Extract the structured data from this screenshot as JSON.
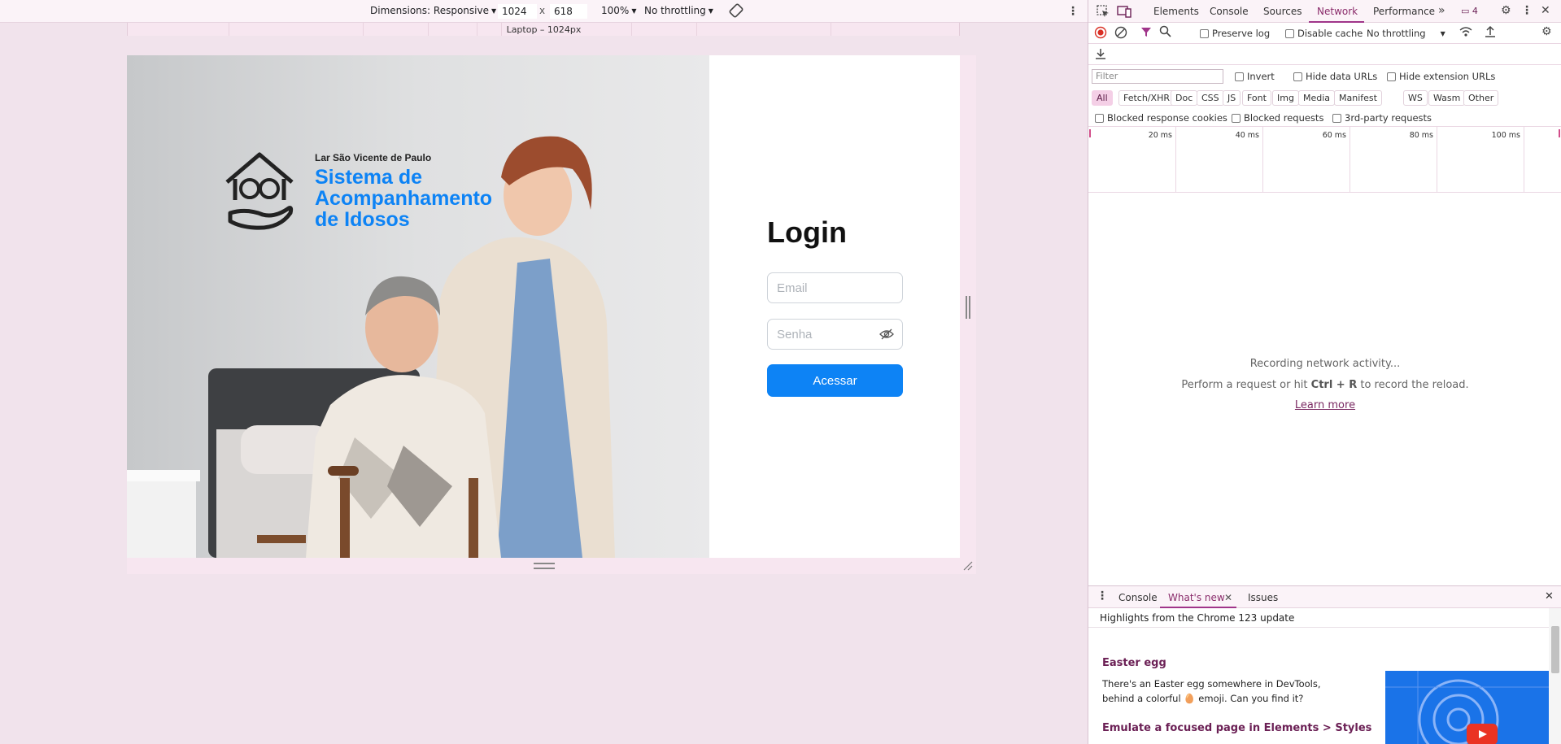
{
  "emulation": {
    "dimensions_label": "Dimensions: Responsive",
    "width_value": "1024",
    "times_sign": "x",
    "height_value": "618",
    "zoom": "100%",
    "throttling": "No throttling",
    "media_label": "Laptop – 1024px"
  },
  "page": {
    "logo_org": "Lar São Vicente de Paulo",
    "logo_title_line1": "Sistema de",
    "logo_title_line2": "Acompanhamento",
    "logo_title_line3": "de Idosos",
    "login_title": "Login",
    "email_placeholder": "Email",
    "password_placeholder": "Senha",
    "login_button": "Acessar",
    "accent_color": "#0d83f5"
  },
  "devtools": {
    "tabs": [
      "Elements",
      "Console",
      "Sources",
      "Network",
      "Performance"
    ],
    "active_tab": "Network",
    "more_tabs_icon": "double-chevron-right-icon",
    "issues_count": "4",
    "toolbar": {
      "preserve_log": "Preserve log",
      "disable_cache": "Disable cache",
      "throttling": "No throttling"
    },
    "filter": {
      "placeholder": "Filter",
      "invert": "Invert",
      "hide_data_urls": "Hide data URLs",
      "hide_extension_urls": "Hide extension URLs"
    },
    "types": [
      "All",
      "Fetch/XHR",
      "Doc",
      "CSS",
      "JS",
      "Font",
      "Img",
      "Media",
      "Manifest",
      "WS",
      "Wasm",
      "Other"
    ],
    "blocked": {
      "response_cookies": "Blocked response cookies",
      "requests": "Blocked requests",
      "third_party": "3rd-party requests"
    },
    "timeline_labels": [
      "20 ms",
      "40 ms",
      "60 ms",
      "80 ms",
      "100 ms"
    ],
    "empty_state": {
      "recording": "Recording network activity...",
      "hint_before": "Perform a request or hit ",
      "hint_key": "Ctrl + R",
      "hint_after": " to record the reload.",
      "learn_more": "Learn more"
    },
    "drawer": {
      "tabs": [
        "Console",
        "What's new",
        "Issues"
      ],
      "active_tab": "What's new",
      "header": "Highlights from the Chrome 123 update",
      "item1_title": "Easter egg",
      "item1_text": "There's an Easter egg somewhere in DevTools, behind a colorful 🥚 emoji. Can you find it?",
      "item2_title": "Emulate a focused page in Elements > Styles"
    },
    "highlight_color": "#a0358a"
  }
}
